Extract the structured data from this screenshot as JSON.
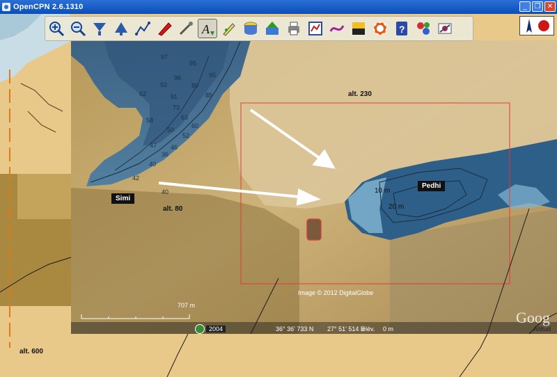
{
  "window": {
    "title": "OpenCPN 2.6.1310",
    "minimize": "_",
    "restore": "❐",
    "close": "✕"
  },
  "toolbar": [
    {
      "name": "zoom-in-icon"
    },
    {
      "name": "zoom-out-icon"
    },
    {
      "name": "scale-down-icon"
    },
    {
      "name": "scale-up-icon"
    },
    {
      "name": "route-icon"
    },
    {
      "name": "ownship-icon"
    },
    {
      "name": "settings-icon"
    },
    {
      "name": "text-annotation-icon",
      "glyph": "A",
      "active": true
    },
    {
      "name": "pencil-icon"
    },
    {
      "name": "tide-icon"
    },
    {
      "name": "current-icon"
    },
    {
      "name": "print-icon"
    },
    {
      "name": "route-manager-icon"
    },
    {
      "name": "track-icon"
    },
    {
      "name": "color-scheme-icon"
    },
    {
      "name": "mob-icon"
    },
    {
      "name": "help-icon",
      "glyph": "?"
    },
    {
      "name": "plugin-icon"
    },
    {
      "name": "chart-tool-icon"
    }
  ],
  "labels": {
    "alt_230": "alt. 230",
    "alt_80": "alt. 80",
    "alt_600": "alt. 600",
    "simi": "Simi",
    "pedhi": "Pedhi",
    "depth_10": "10 m",
    "depth_20": "20 m"
  },
  "depth_soundings": [
    "97",
    "95",
    "96",
    "92",
    "95",
    "80",
    "62",
    "91",
    "85",
    "73",
    "63",
    "60",
    "58",
    "50",
    "52",
    "47",
    "46",
    "36",
    "40",
    "42",
    "40"
  ],
  "google_earth": {
    "scale": "707  m",
    "year": "2004",
    "lat": "36° 36' 733 N",
    "lon": "27° 51' 514 E",
    "elev_label": "élév.",
    "elev_value": "0 m",
    "credit": "Image © 2012 DigitalGlobe",
    "logo": "Goog",
    "altitude_label": "Altitud"
  },
  "colors": {
    "land": "#e8c98a",
    "sea": "#3a6e98",
    "highlight_rect": "#e23a3a",
    "arrow": "#ffffff"
  }
}
